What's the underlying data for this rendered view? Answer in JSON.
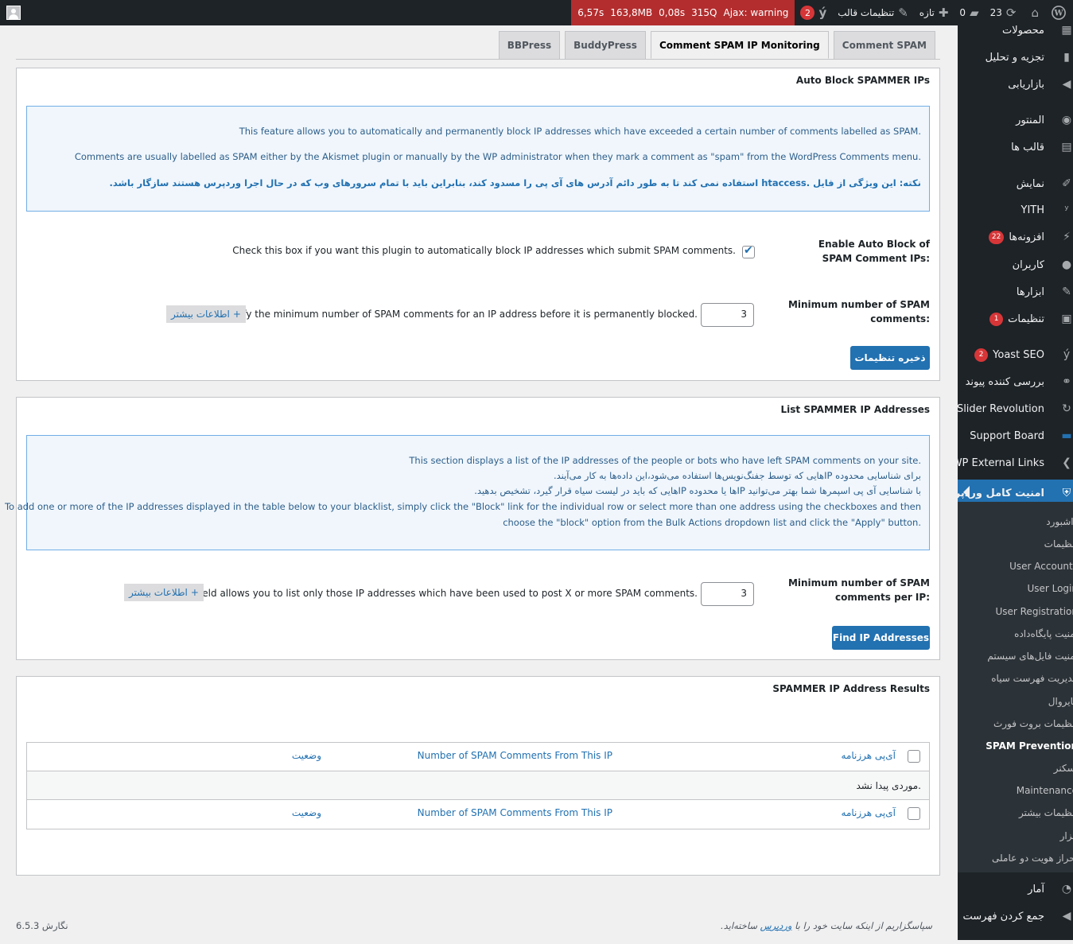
{
  "adminbar": {
    "updates_count": "23",
    "comments_count": "0",
    "new_label": "تازه",
    "theme_settings_label": "تنظیمات قالب",
    "yoast_badge": "2",
    "qm_time": "6,57s",
    "qm_memory": "163,8MB",
    "qm_db_time": "0,08s",
    "qm_queries": "315Q",
    "qm_ajax": "Ajax: warning"
  },
  "sidebar": {
    "items": [
      {
        "label": "محصولات",
        "icon": "archive-icon"
      },
      {
        "label": "تجزیه و تحلیل",
        "icon": "chart-icon"
      },
      {
        "label": "بازاریابی",
        "icon": "megaphone-icon"
      },
      {
        "label": "المنتور",
        "icon": "elementor-icon"
      },
      {
        "label": "قالب ها",
        "icon": "template-icon"
      },
      {
        "label": "نمایش",
        "icon": "brush-icon"
      },
      {
        "label": "YITH",
        "icon": "yith-icon"
      },
      {
        "label": "افزونه‌ها",
        "icon": "plugin-icon",
        "badge": "22"
      },
      {
        "label": "کاربران",
        "icon": "users-icon"
      },
      {
        "label": "ابزارها",
        "icon": "wrench-icon"
      },
      {
        "label": "تنظیمات",
        "icon": "settings-icon",
        "badge": "1"
      },
      {
        "label": "Yoast SEO",
        "icon": "yoast-icon",
        "badge": "2"
      },
      {
        "label": "بررسی کننده پیوند",
        "icon": "link-icon"
      },
      {
        "label": "Slider Revolution",
        "icon": "refresh-icon"
      },
      {
        "label": "Support Board",
        "icon": "chat-icon"
      },
      {
        "label": "WP External Links",
        "icon": "external-icon"
      },
      {
        "label": "امنیت کامل وردپرس",
        "icon": "shield-icon"
      }
    ],
    "submenu": [
      "داشبورد",
      "تنظیمات",
      "User Accounts",
      "User Login",
      "User Registration",
      "امنیت پایگاه‌داده",
      "امنیت فایل‌های سیستم",
      "مدیریت فهرست سیاه",
      "فایروال",
      "تنظیمات بروت فورث",
      "SPAM Prevention",
      "اسکنر",
      "Maintenance",
      "تنظیمات بیشتر",
      "ابزار",
      "احراز هویت دو عاملی"
    ],
    "bottom_items": [
      {
        "label": "آمار",
        "icon": "stats-icon"
      },
      {
        "label": "جمع کردن فهرست",
        "icon": "collapse-icon"
      }
    ]
  },
  "tabs": [
    "Comment SPAM",
    "Comment SPAM IP Monitoring",
    "BuddyPress",
    "BBPress"
  ],
  "auto_block": {
    "title": "Auto Block SPAMMER IPs",
    "info_line1": "This feature allows you to automatically and permanently block IP addresses which have exceeded a certain number of comments labelled as SPAM.",
    "info_line2": "Comments are usually labelled as SPAM either by the Akismet plugin or manually by the WP administrator when they mark a comment as \"spam\" from the WordPress Comments menu.",
    "info_note": "نکته: این ویژگی از فایل .htaccess استفاده نمی کند تا به طور دائم آدرس های آی پی را مسدود کند، بنابراین باید با تمام سرورهای وب که در حال اجرا وردپرس هستند سازگار باشد.",
    "enable_label": "Enable Auto Block of SPAM Comment IPs:",
    "enable_desc": "Check this box if you want this plugin to automatically block IP addresses which submit SPAM comments.",
    "min_label": "Minimum number of SPAM comments:",
    "min_value": "3",
    "min_desc": "Specify the minimum number of SPAM comments for an IP address before it is permanently blocked.",
    "more_info": "اطلاعات بیشتر",
    "save_button": "ذخیره تنظیمات"
  },
  "list_spammer": {
    "title": "List SPAMMER IP Addresses",
    "info_line1": "This section displays a list of the IP addresses of the people or bots who have left SPAM comments on your site.",
    "info_line2": "برای شناسایی محدوده IPهایی که توسط جفنگ‌نویس‌ها استفاده می‌شود،این داده‌ها به کار می‌آیند.",
    "info_line3": "با شناسایی آی پی اسپمرها شما بهتر می‌توانید IPها یا محدوده IPهایی که باید در لیست سیاه قرار گیرد، تشخیص بدهید.",
    "info_line4": "To add one or more of the IP addresses displayed in the table below to your blacklist, simply click the \"Block\" link for the individual row or select more than one address using the checkboxes and then",
    "info_line5": "choose the \"block\" option from the Bulk Actions dropdown list and click the \"Apply\" button.",
    "min_label": "Minimum number of SPAM comments per IP:",
    "min_value": "3",
    "min_desc": "This field allows you to list only those IP addresses which have been used to post X or more SPAM comments.",
    "more_info": "اطلاعات بیشتر",
    "find_button": "Find IP Addresses"
  },
  "results": {
    "title": "SPAMMER IP Address Results",
    "col_ip": "آی‌پی هرزنامه",
    "col_count": "Number of SPAM Comments From This IP",
    "col_status": "وضعیت",
    "empty": "موردی پیدا نشد."
  },
  "footer": {
    "thanks_prefix": "سپاسگزاریم از اینکه سایت خود را با",
    "thanks_link": "وردپرس",
    "thanks_suffix": "ساخته‌اید.",
    "version": "نگارش 6.5.3"
  }
}
